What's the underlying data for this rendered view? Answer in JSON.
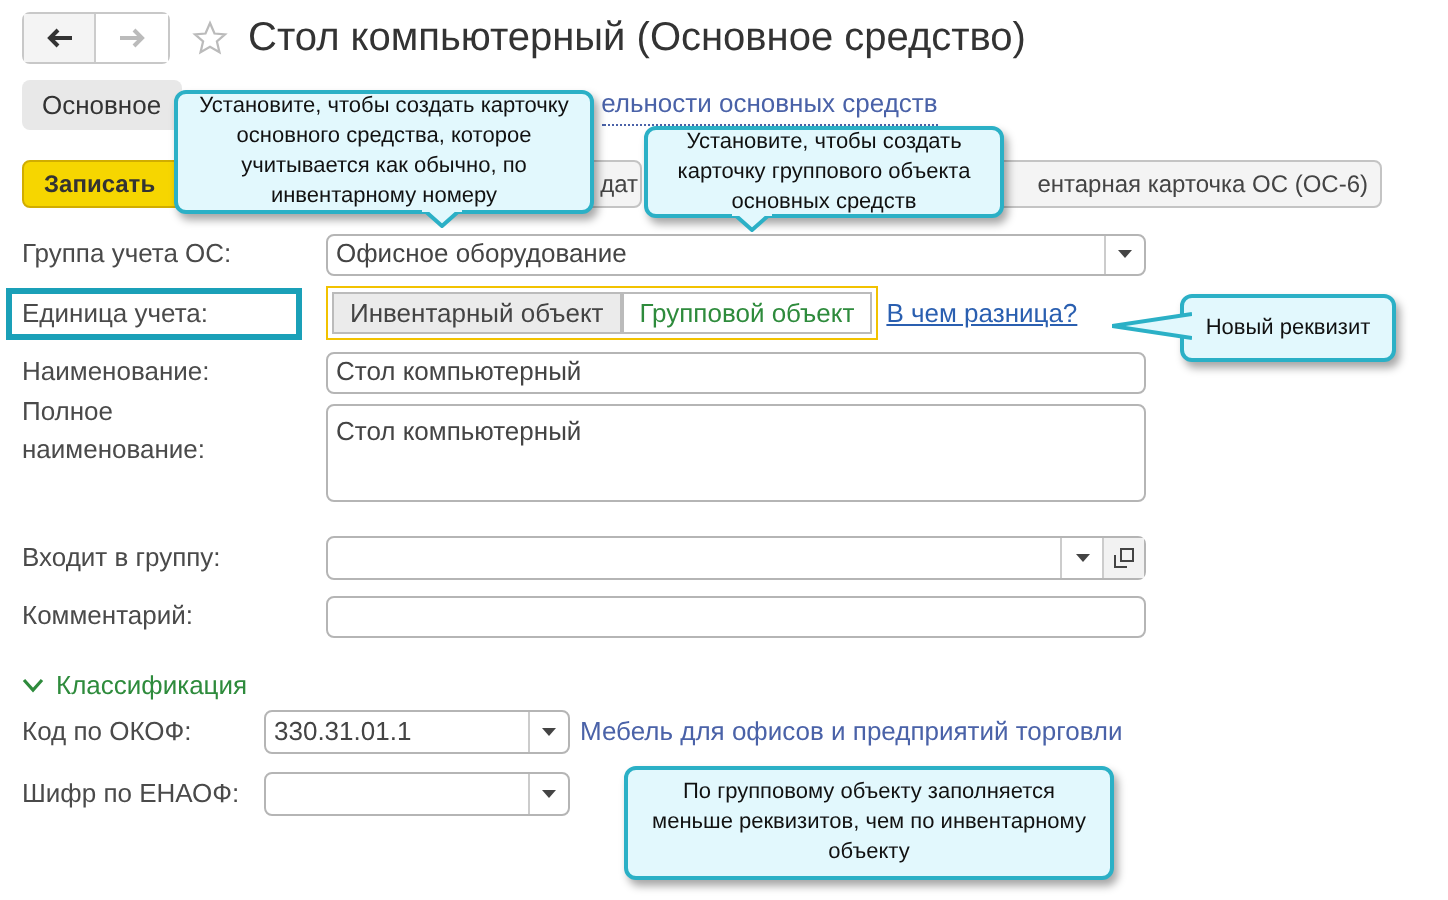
{
  "window": {
    "title": "Стол компьютерный (Основное средство)",
    "favorite": false
  },
  "tabs": [
    {
      "label": "Основное",
      "selected": true
    }
  ],
  "tab_link": "ельности основных средств",
  "toolbar": [
    {
      "label": "Записать",
      "kind": "primary"
    },
    {
      "label": "дат",
      "kind": "plain"
    },
    {
      "label": "ентарная карточка ОС (ОС-6)",
      "kind": "plain"
    }
  ],
  "fields": [
    {
      "kind": "select",
      "label": "Группа учета ОС:",
      "value": "Офисное оборудование"
    },
    {
      "kind": "toggle",
      "label": "Единица учета:",
      "highlighted": true,
      "options": [
        {
          "label": "Инвентарный объект",
          "selected": false
        },
        {
          "label": "Групповой объект",
          "selected": true
        }
      ],
      "link": "В чем разница?"
    },
    {
      "kind": "text",
      "label": "Наименование:",
      "value": "Стол компьютерный"
    },
    {
      "kind": "textarea",
      "label": "Полное наименование:",
      "value": "Стол компьютерный"
    },
    {
      "kind": "select_open",
      "label": "Входит в группу:"
    },
    {
      "kind": "text",
      "label": "Комментарий:"
    }
  ],
  "section": {
    "title": "Классификация",
    "expanded": true,
    "fields": [
      {
        "label": "Код по ОКОФ:",
        "value": "330.31.01.1",
        "link": "Мебель для офисов и предприятий торговли"
      },
      {
        "label": "Шифр по ЕНАОФ:"
      }
    ]
  },
  "callouts": [
    {
      "text": "Установите, чтобы создать карточку основного средства, которое учитывается как обычно, по инвентарному номеру",
      "kind": "down"
    },
    {
      "text": "Установите, чтобы создать карточку группового объекта основных средств",
      "kind": "down"
    },
    {
      "text": "Новый реквизит",
      "kind": "left"
    },
    {
      "text": "По групповому объекту заполняется меньше реквизитов, чем по инвентарному объекту",
      "kind": "plain"
    }
  ]
}
